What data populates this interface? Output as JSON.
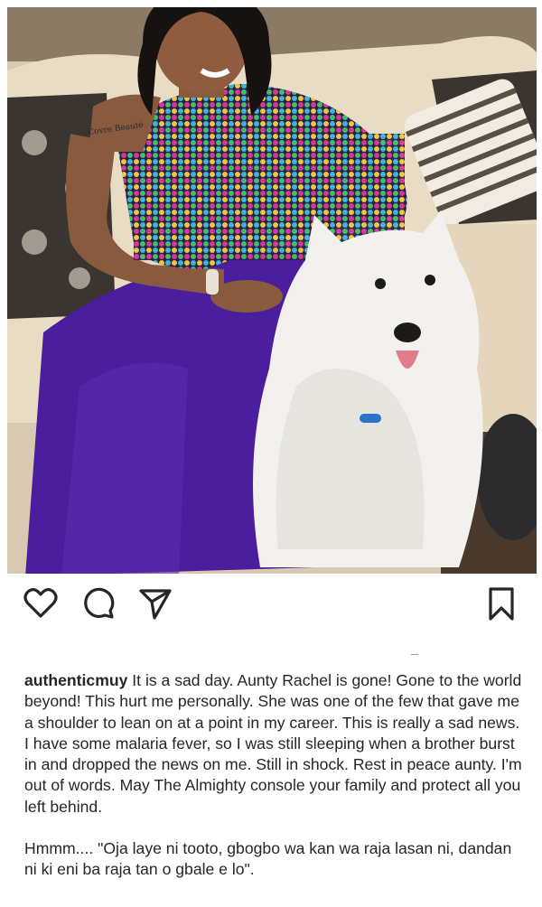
{
  "post": {
    "photo_watermark": "Covre Beauté",
    "username": "authenticmuy",
    "caption_text": "It is a sad day. Aunty Rachel is gone! Gone to the world beyond! This hurt me personally. She was one of the few that gave me a shoulder to lean on at a point in my career. This is really a sad news. I have some malaria fever, so I was still sleeping when a brother burst in and dropped the news on me. Still in shock. Rest in peace aunty. I'm out of words. May The Almighty console your family and protect all you left behind.",
    "caption_second_paragraph": "Hmmm.... \"Oja laye ni tooto, gbogbo wa kan wa raja lasan ni, dandan ni ki eni ba raja tan o gbale e lo\"."
  },
  "actions": {
    "like_icon": "heart-outline-icon",
    "comment_icon": "speech-bubble-icon",
    "share_icon": "paper-plane-icon",
    "save_icon": "bookmark-icon"
  },
  "colors": {
    "dress_purple": "#4b1e9e",
    "icon_color": "#262626"
  }
}
